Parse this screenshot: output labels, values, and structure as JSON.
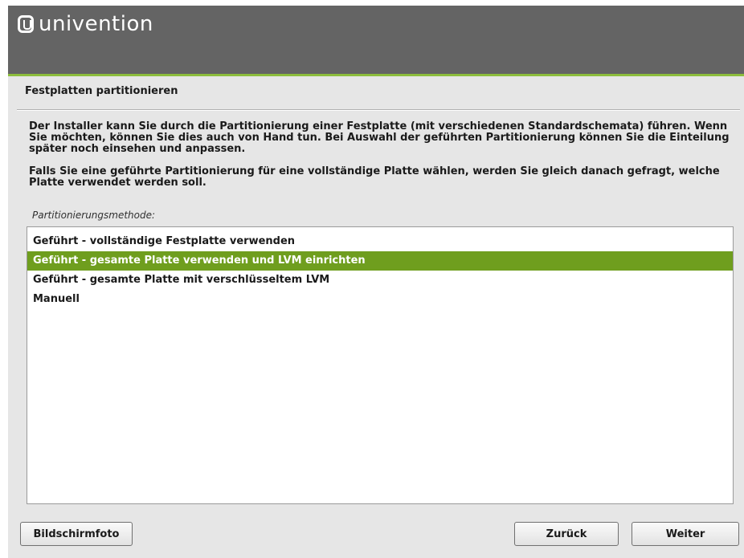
{
  "brand": {
    "logo_text": "univention"
  },
  "page": {
    "title": "Festplatten partitionieren"
  },
  "description": {
    "paragraph1": "Der Installer kann Sie durch die Partitionierung einer Festplatte (mit verschiedenen Standardschemata) führen. Wenn Sie möchten, können Sie dies auch von Hand tun. Bei Auswahl der geführten Partitionierung können Sie die Einteilung später noch einsehen und anpassen.",
    "paragraph2": "Falls Sie eine geführte Partitionierung für eine vollständige Platte wählen, werden Sie gleich danach gefragt, welche Platte verwendet werden soll."
  },
  "method_list": {
    "label": "Partitionierungsmethode:",
    "options": [
      "Geführt - vollständige Festplatte verwenden",
      "Geführt - gesamte Platte verwenden und LVM einrichten",
      "Geführt - gesamte Platte mit verschlüsseltem LVM",
      "Manuell"
    ],
    "selected_index": 1
  },
  "buttons": {
    "screenshot": "Bildschirmfoto",
    "back": "Zurück",
    "next": "Weiter"
  },
  "colors": {
    "header_bg": "#646464",
    "accent_green": "#8cbd3c",
    "selection_bg": "#6f9e1e"
  }
}
